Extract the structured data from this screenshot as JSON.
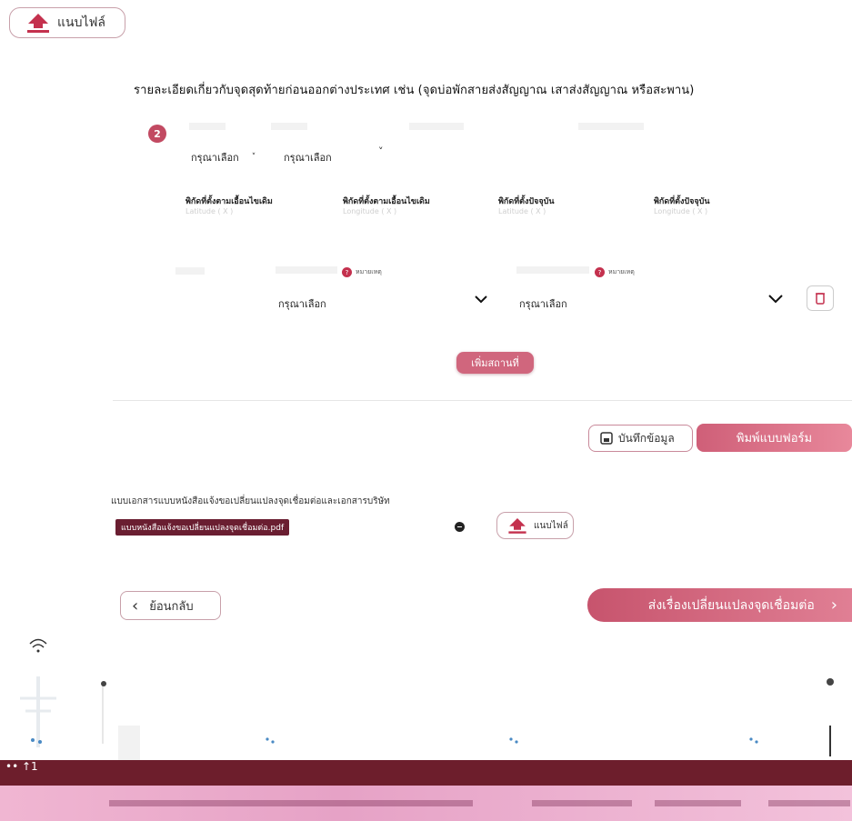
{
  "top_upload": {
    "label": "แนบไฟล์"
  },
  "section": {
    "title": "รายละเอียดเกี่ยวกับจุดสุดท้ายก่อนออกต่างประเทศ เช่น (จุดบ่อพักสายส่งสัญญาณ เสาส่งสัญญาณ หรือสะพาน)"
  },
  "step": {
    "number": "2",
    "select_one": "กรุณาเลือก",
    "select_two": "กรุณาเลือก",
    "coords": [
      {
        "label": "พิกัดที่ตั้งตามเอื้อนไขเดิม",
        "placeholder": "Latitude ( X )"
      },
      {
        "label": "พิกัดที่ตั้งตามเอื้อนไขเดิม",
        "placeholder": "Longitude ( X )"
      },
      {
        "label": "พิกัดที่ตั้งปัจจุบัน",
        "placeholder": "Latitude ( X )"
      },
      {
        "label": "พิกัดที่ตั้งปัจจุบัน",
        "placeholder": "Longitude ( X )"
      }
    ],
    "help_text": "หมายเหตุ",
    "select_three": "กรุณาเลือก",
    "select_four": "กรุณาเลือก",
    "add_place_label": "เพิ่มสถานที่"
  },
  "actions": {
    "save_label": "บันทึกข้อมูล",
    "print_label": "พิมพ์แบบฟอร์ม"
  },
  "attachment": {
    "title": "แบบเอกสารแบบหนังสือแจ้งขอเปลี่ยนแปลงจุดเชื่อมต่อและเอกสารบริษัท",
    "file_name": "แบบหนังสือแจ้งขอเปลี่ยนแปลงจุดเชื่อมต่อ.pdf",
    "upload_label": "แนบไฟล์"
  },
  "nav": {
    "back_label": "ย้อนกลับ",
    "submit_label": "ส่งเรื่องเปลี่ยนแปลงจุดเชื่อมต่อ",
    "submit_arrow": "›",
    "back_arrow": "‹"
  },
  "colors": {
    "accent": "#c24a62",
    "footer_dark": "#6d1e2c",
    "footer_pink": "#f0b6d2"
  },
  "icons": {
    "upload": "upload-arrow-icon",
    "chevron": "chevron-down-icon",
    "trash": "trash-icon",
    "save": "save-disk-icon",
    "remove": "remove-circle-icon"
  }
}
